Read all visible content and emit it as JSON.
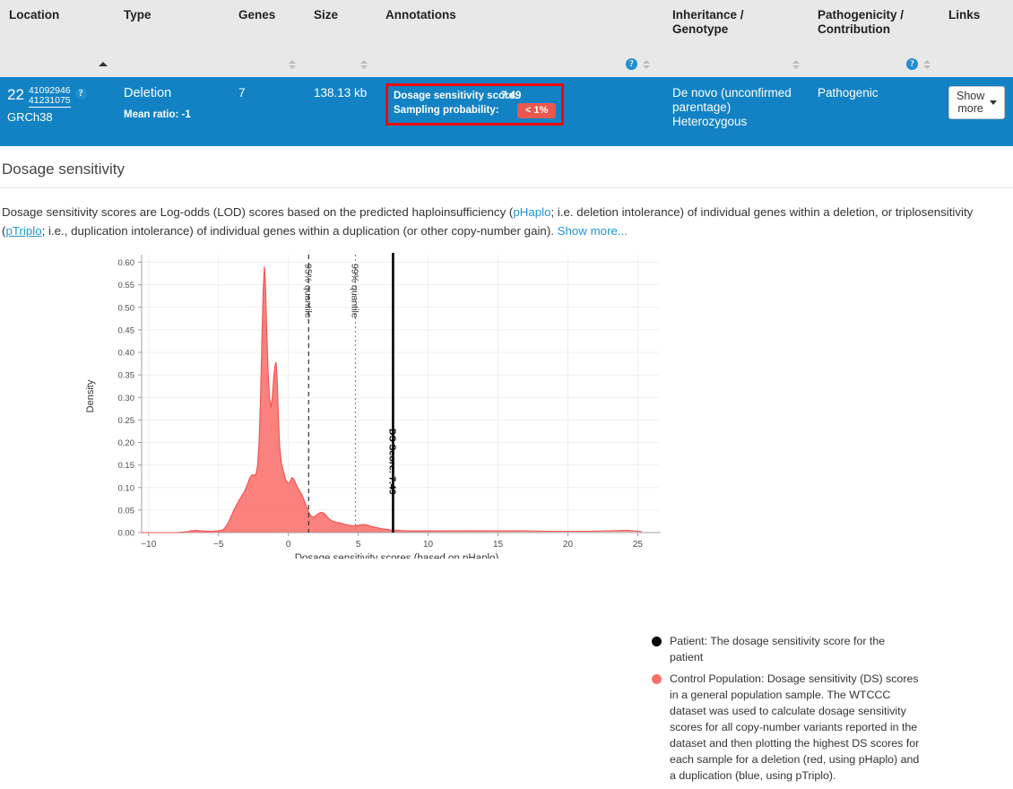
{
  "table": {
    "columns": [
      {
        "label": "Location"
      },
      {
        "label": "Type"
      },
      {
        "label": "Genes"
      },
      {
        "label": "Size"
      },
      {
        "label": "Annotations"
      },
      {
        "label": "Inheritance /\nGenotype"
      },
      {
        "label": "Pathogenicity /\nContribution"
      },
      {
        "label": "Links"
      }
    ],
    "col_inheritance_l1": "Inheritance /",
    "col_inheritance_l2": "Genotype",
    "col_pathogenicity_l1": "Pathogenicity /",
    "col_pathogenicity_l2": "Contribution",
    "sort_row": {
      "location_sort": "sort-ascending-icon",
      "genes_sort": "sort-both-icon",
      "size_sort": "sort-both-icon",
      "annotations_sort": "sort-both-icon",
      "annotations_help": "?",
      "inheritance_sort": "sort-both-icon",
      "pathogenicity_help": "?",
      "pathogenicity_sort": "sort-both-icon"
    },
    "row": {
      "chromosome": "22",
      "position_start": "41092946",
      "position_end": "41231075",
      "help": "?",
      "genome_build": "GRCh38",
      "type": "Deletion",
      "mean_ratio": "Mean ratio: -1",
      "genes": "7",
      "size": "138.13 kb",
      "annotation_label_1": "Dosage sensitivity score:",
      "annotation_value_1": "7.49",
      "annotation_label_2": "Sampling probability:",
      "annotation_value_2": "< 1%",
      "inheritance_line1": "De novo (unconfirmed",
      "inheritance_line2": "parentage)",
      "inheritance_line3": "Heterozygous",
      "pathogenicity": "Pathogenic",
      "show_more": "Show more"
    }
  },
  "section": {
    "title": "Dosage sensitivity",
    "desc_part1": "Dosage sensitivity scores are Log-odds (LOD) scores based on the predicted haploinsufficiency (",
    "desc_link1": "pHaplo",
    "desc_part2": "; i.e. deletion intolerance) of individual genes within a deletion, or triplosensitivity (",
    "desc_link2": "pTriplo",
    "desc_part3": "; i.e., duplication intolerance) of individual genes within a duplication (or other copy-number gain). ",
    "desc_link3": "Show more..."
  },
  "colors": {
    "row_blue": "#1282c5",
    "header_gray": "#e8e8e8",
    "highlight_red": "#ff0000",
    "pill_red": "#e8584f",
    "link_blue": "#2196d6",
    "density_fill": "#f9706b",
    "density_stroke": "#ef5350",
    "patient_black": "#000000"
  },
  "chart_data": {
    "type": "area",
    "title": "",
    "xlabel": "Dosage sensitivity scores (based on pHaplo)",
    "ylabel": "Density",
    "xlim": [
      -10.5,
      26
    ],
    "ylim": [
      0.0,
      0.605
    ],
    "xticks": [
      -10,
      -5,
      0,
      5,
      10,
      15,
      20,
      25
    ],
    "xticklabels": [
      "−10",
      "−5",
      "0",
      "5",
      "10",
      "15",
      "20",
      "25"
    ],
    "yticks": [
      0.0,
      0.05,
      0.1,
      0.15,
      0.2,
      0.25,
      0.3,
      0.35,
      0.4,
      0.45,
      0.5,
      0.55,
      0.6
    ],
    "yticklabels": [
      "0.00",
      "0.05",
      "0.10",
      "0.15",
      "0.20",
      "0.25",
      "0.30",
      "0.35",
      "0.40",
      "0.45",
      "0.50",
      "0.55",
      "0.60"
    ],
    "grid": true,
    "legend_position": "right",
    "series": [
      {
        "name": "Control Population",
        "type": "density-area",
        "color": "#f9706b",
        "x": [
          -10.5,
          -8.0,
          -7.2,
          -7.0,
          -6.6,
          -6.2,
          -5.8,
          -5.4,
          -5.2,
          -5.0,
          -4.7,
          -4.5,
          -4.3,
          -4.1,
          -3.9,
          -3.7,
          -3.5,
          -3.3,
          -3.1,
          -2.9,
          -2.75,
          -2.6,
          -2.5,
          -2.4,
          -2.3,
          -2.2,
          -2.1,
          -2.0,
          -1.9,
          -1.8,
          -1.72,
          -1.65,
          -1.55,
          -1.45,
          -1.35,
          -1.25,
          -1.15,
          -1.05,
          -0.95,
          -0.88,
          -0.8,
          -0.72,
          -0.62,
          -0.5,
          -0.35,
          -0.2,
          -0.05,
          0.1,
          0.25,
          0.4,
          0.55,
          0.7,
          0.85,
          1.0,
          1.15,
          1.3,
          1.45,
          1.6,
          1.75,
          1.9,
          2.05,
          2.2,
          2.35,
          2.5,
          2.65,
          2.8,
          3.0,
          3.2,
          3.4,
          3.6,
          3.85,
          4.1,
          4.4,
          4.7,
          5.0,
          5.3,
          5.6,
          5.9,
          6.3,
          6.8,
          7.3,
          7.9,
          8.5,
          9.2,
          10.0,
          11.0,
          12.0,
          13.0,
          14.0,
          15.5,
          17.0,
          18.5,
          20.0,
          21.5,
          23.0,
          24.3,
          25.3,
          25.8
        ],
        "y": [
          0.0,
          0.0,
          0.002,
          0.004,
          0.005,
          0.004,
          0.003,
          0.003,
          0.004,
          0.004,
          0.006,
          0.012,
          0.022,
          0.036,
          0.05,
          0.062,
          0.073,
          0.083,
          0.094,
          0.11,
          0.122,
          0.128,
          0.128,
          0.127,
          0.132,
          0.15,
          0.2,
          0.29,
          0.42,
          0.54,
          0.59,
          0.56,
          0.45,
          0.36,
          0.3,
          0.278,
          0.3,
          0.345,
          0.372,
          0.378,
          0.34,
          0.26,
          0.19,
          0.155,
          0.135,
          0.118,
          0.11,
          0.112,
          0.122,
          0.118,
          0.108,
          0.098,
          0.09,
          0.082,
          0.07,
          0.058,
          0.046,
          0.038,
          0.034,
          0.036,
          0.04,
          0.043,
          0.045,
          0.044,
          0.04,
          0.034,
          0.028,
          0.025,
          0.023,
          0.022,
          0.02,
          0.018,
          0.016,
          0.015,
          0.016,
          0.018,
          0.017,
          0.014,
          0.011,
          0.008,
          0.006,
          0.005,
          0.004,
          0.004,
          0.004,
          0.004,
          0.004,
          0.004,
          0.004,
          0.004,
          0.004,
          0.003,
          0.003,
          0.003,
          0.004,
          0.005,
          0.002
        ]
      },
      {
        "name": "Patient",
        "type": "vline",
        "color": "#000000",
        "x": 7.49,
        "label": "DS Score: 7.49"
      }
    ],
    "vlines": [
      {
        "name": "95% quantile",
        "x": 1.45,
        "style": "dashed",
        "color": "#333333",
        "label": "95% quantile"
      },
      {
        "name": "99% quantile",
        "x": 4.8,
        "style": "dotted",
        "color": "#888888",
        "label": "99% quantile"
      }
    ],
    "legend": [
      {
        "color": "#000000",
        "text": "Patient: The dosage sensitivity score for the patient"
      },
      {
        "color": "#f9706b",
        "text": "Control Population: Dosage sensitivity (DS) scores in a general population sample. The WTCCC dataset was used to calculate dosage sensitivity scores for all copy-number variants reported in the dataset and then plotting the highest DS scores for each sample for a deletion (red, using pHaplo) and a duplication (blue, using pTriplo)."
      }
    ]
  }
}
